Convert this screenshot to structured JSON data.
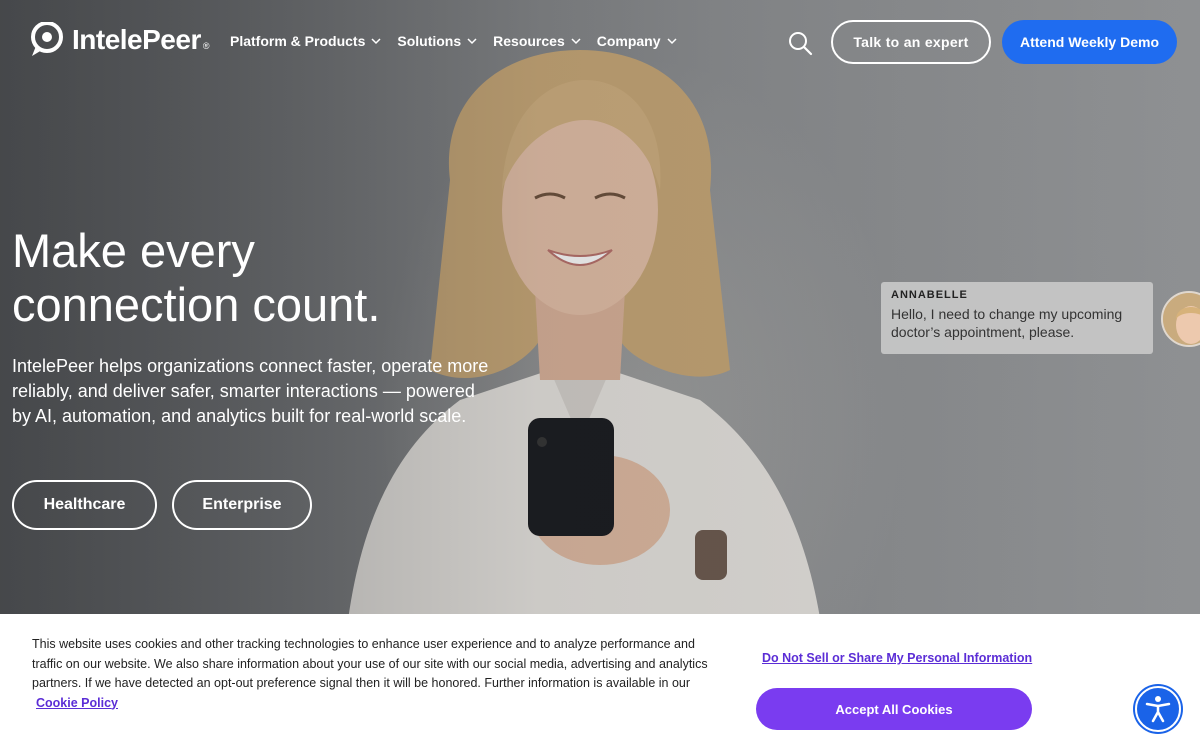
{
  "brand": {
    "name": "IntelePeer",
    "reg_mark": "®",
    "accent": "#1f6cf0"
  },
  "nav": {
    "items": [
      {
        "label": "Platform & Products",
        "icon": "chevron-down-icon"
      },
      {
        "label": "Solutions",
        "icon": "chevron-down-icon"
      },
      {
        "label": "Resources",
        "icon": "chevron-down-icon"
      },
      {
        "label": "Company",
        "icon": "chevron-down-icon"
      }
    ],
    "search_icon": "search-icon",
    "expert_label": "Talk to an expert",
    "demo_label": "Attend Weekly Demo"
  },
  "hero": {
    "headline_line1": "Make every",
    "headline_line2": "connection count.",
    "subtext": "IntelePeer helps organizations connect faster, operate more reliably, and deliver safer, smarter interactions — powered by AI, automation, and analytics built for real-world scale.",
    "pills": [
      "Healthcare",
      "Enterprise"
    ]
  },
  "chat": {
    "name": "ANNABELLE",
    "message": "Hello, I need to change my upcoming doctor’s appointment, please."
  },
  "cookie": {
    "text": "This website uses cookies and other tracking technologies to enhance user experience and to analyze performance and traffic on our website. We also share information about your use of our site with our social media, advertising and analytics partners. If we have detected an opt-out preference signal then it will be honored. Further information is available in our",
    "policy_link": "Cookie Policy",
    "dns_link": "Do Not Sell or Share My Personal Information",
    "accept_label": "Accept All Cookies",
    "accept_color": "#7a3cf0"
  },
  "accessibility": {
    "icon": "accessibility-icon"
  }
}
